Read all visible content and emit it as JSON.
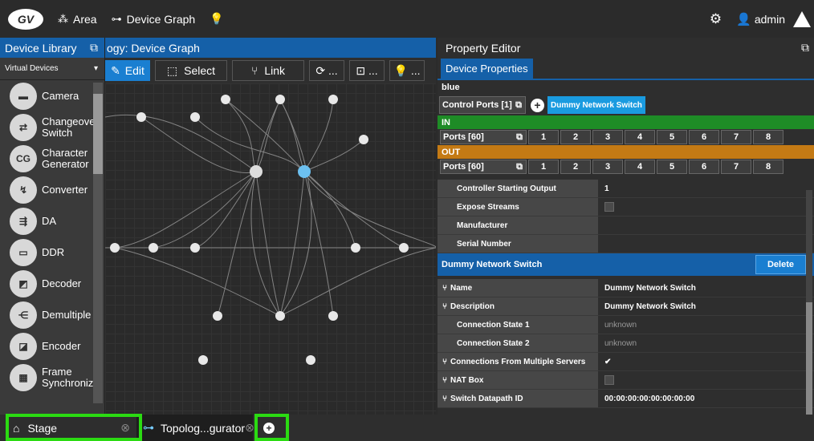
{
  "topbar": {
    "logo": "GV",
    "area": "Area",
    "device_graph": "Device Graph",
    "user": "admin"
  },
  "library": {
    "title": "Device Library",
    "filter": "Virtual Devices",
    "items": [
      {
        "label": "Camera",
        "icon": "camera-icon",
        "glyph": "▬"
      },
      {
        "label": "Changeove Switch",
        "icon": "changeover-icon",
        "glyph": "⇄"
      },
      {
        "label": "Character Generator",
        "icon": "cg-icon",
        "glyph": "CG"
      },
      {
        "label": "Converter",
        "icon": "converter-icon",
        "glyph": "↯"
      },
      {
        "label": "DA",
        "icon": "da-icon",
        "glyph": "⇶"
      },
      {
        "label": "DDR",
        "icon": "ddr-icon",
        "glyph": "▭"
      },
      {
        "label": "Decoder",
        "icon": "decoder-icon",
        "glyph": "◩"
      },
      {
        "label": "Demultiple",
        "icon": "demux-icon",
        "glyph": "⋲"
      },
      {
        "label": "Encoder",
        "icon": "encoder-icon",
        "glyph": "◪"
      },
      {
        "label": "Frame Synchroniz",
        "icon": "framesync-icon",
        "glyph": "▦"
      }
    ]
  },
  "graph": {
    "title": "ogy: Device Graph",
    "edit": "Edit",
    "select": "Select",
    "link": "Link",
    "more": "..."
  },
  "property": {
    "title": "Property Editor",
    "tab": "Device Properties",
    "name": "blue",
    "control_ports": "Control Ports [1]",
    "device": "Dummy Network Switch",
    "in_label": "IN",
    "out_label": "OUT",
    "ports_in": "Ports [60]",
    "ports_out": "Ports [60]",
    "port_numbers": [
      "1",
      "2",
      "3",
      "4",
      "5",
      "6",
      "7",
      "8"
    ],
    "rows1": [
      {
        "k": "Controller Starting Output",
        "v": "1"
      },
      {
        "k": "Expose Streams",
        "v": "",
        "check": true
      },
      {
        "k": "Manufacturer",
        "v": ""
      },
      {
        "k": "Serial Number",
        "v": ""
      }
    ],
    "section": "Dummy Network Switch",
    "delete": "Delete",
    "rows2": [
      {
        "k": "Name",
        "v": "Dummy Network Switch",
        "link": true
      },
      {
        "k": "Description",
        "v": "Dummy Network Switch",
        "link": true
      },
      {
        "k": "Connection State 1",
        "v": "unknown",
        "dim": true
      },
      {
        "k": "Connection State 2",
        "v": "unknown",
        "dim": true
      },
      {
        "k": "Connections From Multiple Servers",
        "v": "✔",
        "link": true
      },
      {
        "k": "NAT Box",
        "v": "",
        "check": true,
        "link": true
      },
      {
        "k": "Switch Datapath ID",
        "v": "00:00:00:00:00:00:00:00",
        "link": true
      }
    ]
  },
  "tabs": {
    "stage": "Stage",
    "topology": "Topolog...gurator"
  }
}
